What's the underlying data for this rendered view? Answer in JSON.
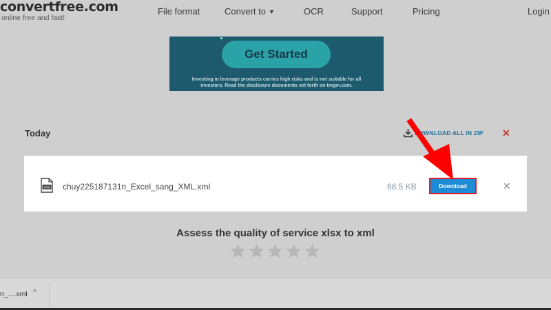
{
  "header": {
    "logo": "convertfree.com",
    "tagline": "online free and fast!",
    "nav": {
      "file_format": "File format",
      "convert_to": "Convert to",
      "ocr": "OCR",
      "support": "Support",
      "pricing": "Pricing",
      "login": "Login"
    }
  },
  "ad": {
    "button": "Get Started",
    "disclaimer_line1": "Investing in leverage products carries high risks and is not suitable for all",
    "disclaimer_line2": "investors. Read the disclosure documents set forth on tmgm.com."
  },
  "results": {
    "section_title": "Today",
    "download_all": "DOWNLOAD ALL IN ZIP",
    "clear_icon": "close-icon"
  },
  "file": {
    "icon": "xml-file-icon",
    "name": "chuy225187131n_Excel_sang_XML.xml",
    "size": "68.5 KB",
    "download_label": "Download",
    "remove_icon": "close-icon"
  },
  "rating": {
    "title": "Assess the quality of service xlsx to xml",
    "stars_total": 5,
    "stars_filled": 0
  },
  "download_bar": {
    "item_label": "n_....xml",
    "caret": "^"
  },
  "colors": {
    "accent_button": "#1e8bd6",
    "highlight_border": "#e31b23",
    "annotation_arrow": "#ff0000",
    "link": "#1f6f9a"
  }
}
